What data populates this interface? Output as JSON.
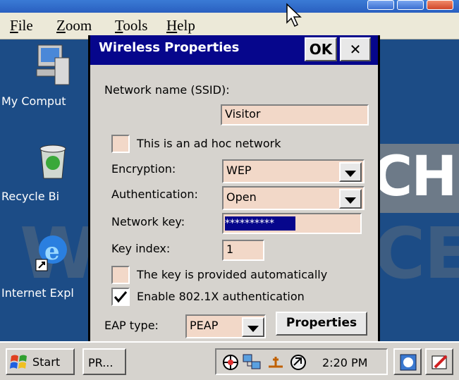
{
  "menubar": {
    "items": [
      "File",
      "Zoom",
      "Tools",
      "Help"
    ],
    "underline": [
      "F",
      "Z",
      "T",
      "H"
    ]
  },
  "desktop": {
    "icons": [
      {
        "label": "My Comput"
      },
      {
        "label": "Recycle Bi"
      },
      {
        "label": "Internet Expl"
      }
    ],
    "watermark": [
      "CH",
      "W",
      "CE"
    ]
  },
  "dialog": {
    "title": "Wireless Properties",
    "ok_label": "OK",
    "close_label": "✕",
    "ssid_label": "Network name (SSID):",
    "ssid_value": "Visitor",
    "adhoc_label": "This is an ad hoc network",
    "adhoc_checked": false,
    "encryption_label": "Encryption:",
    "encryption_value": "WEP",
    "authentication_label": "Authentication:",
    "authentication_value": "Open",
    "network_key_label": "Network key:",
    "network_key_value": "**********",
    "key_index_label": "Key index:",
    "key_index_value": "1",
    "auto_key_label": "The key is provided automatically",
    "auto_key_checked": false,
    "enable_8021x_label": "Enable 802.1X authentication",
    "enable_8021x_checked": true,
    "eap_type_label": "EAP type:",
    "eap_type_value": "PEAP",
    "properties_label": "Properties"
  },
  "taskbar": {
    "start_label": "Start",
    "task_label": "PR...",
    "clock": "2:20 PM"
  },
  "colors": {
    "dialog_title_bg": "#06068c",
    "field_bg": "#f2d8c8",
    "desktop_bg": "#1c4c86",
    "selection": "#06068c"
  }
}
